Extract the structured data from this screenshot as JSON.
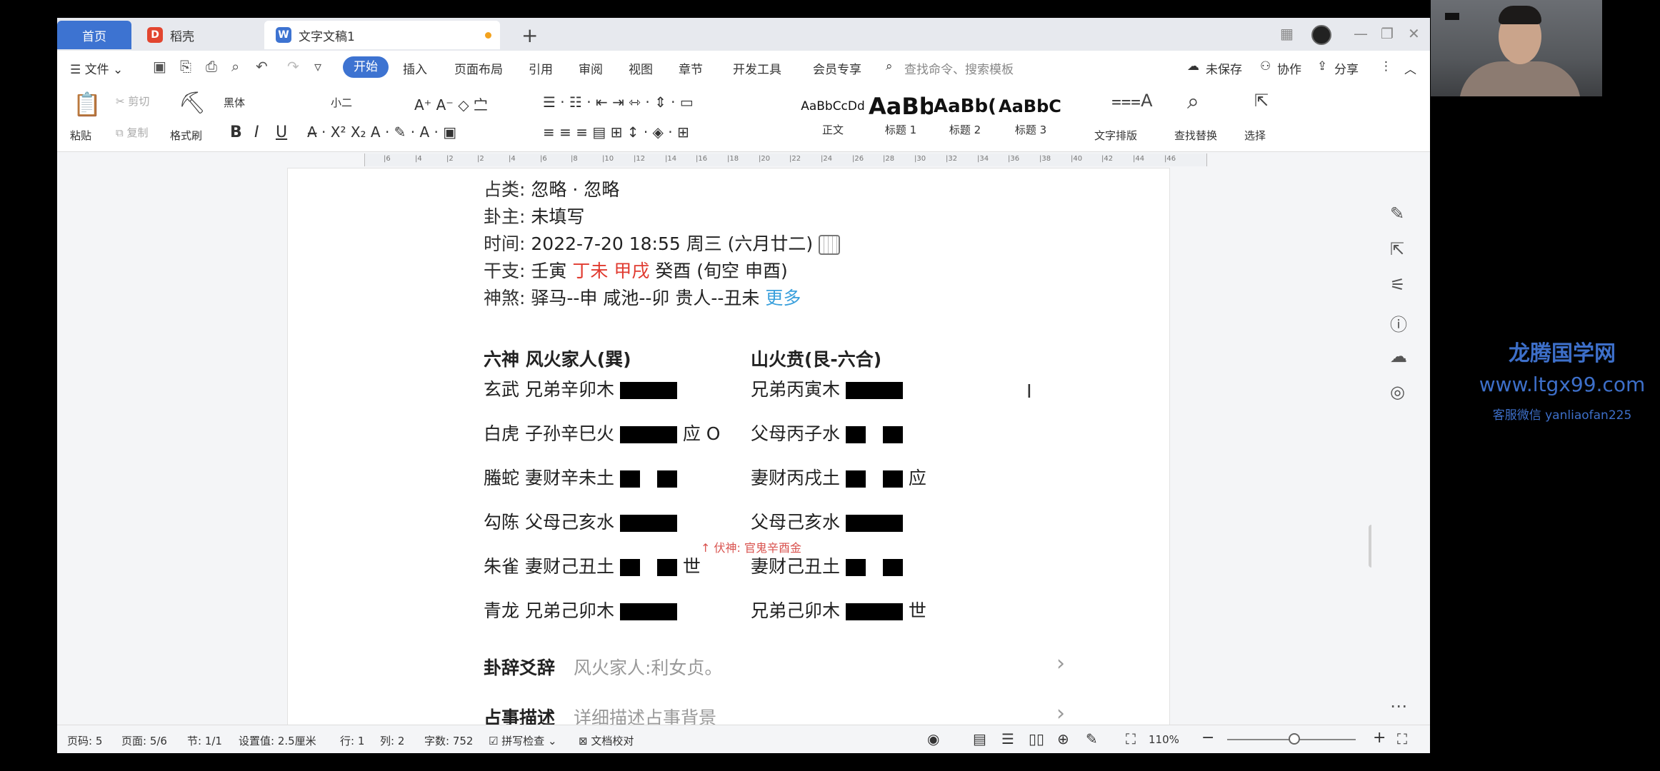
{
  "tabs": {
    "home": "首页",
    "docer": "稻壳",
    "doc": "文字文稿1",
    "add": "+"
  },
  "menu": {
    "file": "☰ 文件 ⌄",
    "items": [
      "开始",
      "插入",
      "页面布局",
      "引用",
      "审阅",
      "视图",
      "章节",
      "开发工具",
      "会员专享"
    ],
    "search": "查找命令、搜索模板",
    "unsaved": "未保存",
    "collab": "协作",
    "share": "分享"
  },
  "ribbon": {
    "paste": "粘贴",
    "cut": "剪切",
    "copy": "复制",
    "format_painter": "格式刷",
    "font_name": "黑体",
    "font_size": "小二",
    "style_samples": [
      "AaBbCcDd",
      "AaBb",
      "AaBb(",
      "AaBbC("
    ],
    "style_names": [
      "正文",
      "标题 1",
      "标题 2",
      "标题 3"
    ],
    "text_layout": "文字排版",
    "find_replace": "查找替换",
    "select": "选择"
  },
  "ruler": [
    "6",
    "4",
    "2",
    "2",
    "4",
    "6",
    "8",
    "10",
    "12",
    "14",
    "16",
    "18",
    "20",
    "22",
    "24",
    "26",
    "28",
    "30",
    "32",
    "34",
    "36",
    "38",
    "40",
    "42",
    "44",
    "46"
  ],
  "doc": {
    "category_label": "占类:",
    "category_value": "忽略 · 忽略",
    "owner_label": "卦主:",
    "owner_value": "未填写",
    "time_label": "时间:",
    "time_value": "2022-7-20 18:55 周三 (六月廿二)",
    "ganzhi_label": "干支:",
    "ganzhi_1": "壬寅",
    "ganzhi_2": "丁未",
    "ganzhi_3": "甲戌",
    "ganzhi_4": "癸酉 (旬空 申酉)",
    "shensha_label": "神煞:",
    "shensha_value": "驿马--申  咸池--卯  贵人--丑未",
    "more": "更多",
    "header_left": "六神 风火家人(巽)",
    "header_right": "山火贲(艮-六合)",
    "lines": [
      {
        "left": "玄武 兄弟辛卯木",
        "left_mark": "",
        "right": "兄弟丙寅木",
        "right_mark": ""
      },
      {
        "left": "白虎 子孙辛巳火",
        "left_mark": "应 O",
        "right": "父母丙子水",
        "right_mark": ""
      },
      {
        "left": "螣蛇 妻财辛未土",
        "left_mark": "",
        "right": "妻财丙戌土",
        "right_mark": "应"
      },
      {
        "left": "勾陈 父母己亥水",
        "left_mark": "",
        "right": "父母己亥水",
        "right_mark": ""
      },
      {
        "left": "朱雀 妻财己丑土",
        "left_mark": "世",
        "right": "妻财己丑土",
        "right_mark": ""
      },
      {
        "left": "青龙 兄弟己卯木",
        "left_mark": "",
        "right": "兄弟己卯木",
        "right_mark": "世"
      }
    ],
    "fushen": "↑ 伏神: 官鬼辛酉金",
    "guaci_label": "卦辞爻辞",
    "guaci_value": "风火家人:利女贞。",
    "desc_label": "占事描述",
    "desc_placeholder": "详细描述占事背景"
  },
  "status": {
    "page_no": "页码: 5",
    "pages": "页面: 5/6",
    "section": "节: 1/1",
    "setting": "设置值: 2.5厘米",
    "row": "行: 1",
    "col": "列: 2",
    "words": "字数: 752",
    "spell": "拼写检查",
    "proof": "文档校对",
    "zoom": "110%"
  },
  "watermark": {
    "line1": "龙腾国学网",
    "line2": "www.ltgx99.com",
    "line3": "客服微信 yanliaofan225"
  }
}
